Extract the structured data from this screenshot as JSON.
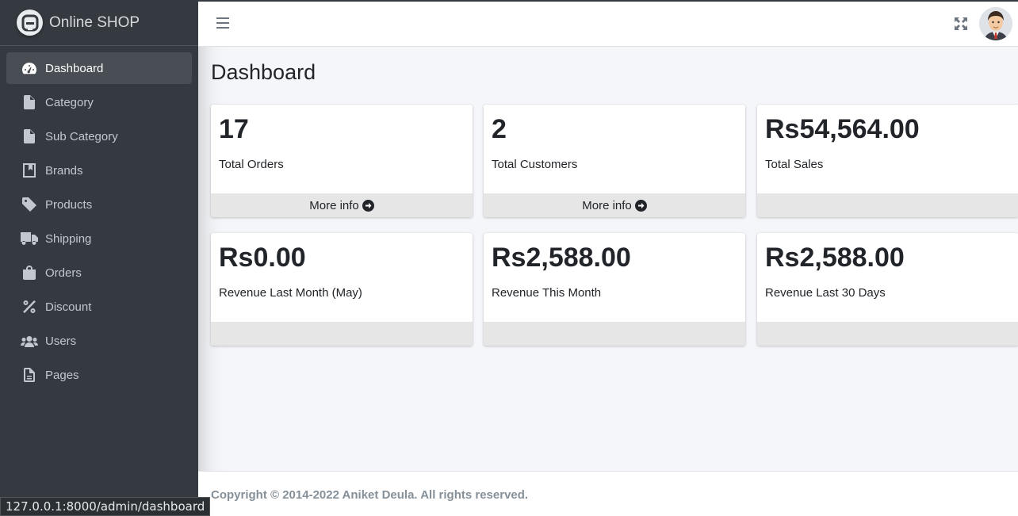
{
  "brand": {
    "name": "Online SHOP"
  },
  "sidebar": {
    "items": [
      {
        "label": "Dashboard",
        "icon": "tachometer-icon",
        "active": true
      },
      {
        "label": "Category",
        "icon": "file-icon"
      },
      {
        "label": "Sub Category",
        "icon": "file-icon"
      },
      {
        "label": "Brands",
        "icon": "book-icon"
      },
      {
        "label": "Products",
        "icon": "tag-icon"
      },
      {
        "label": "Shipping",
        "icon": "truck-icon"
      },
      {
        "label": "Orders",
        "icon": "shopping-bag-icon"
      },
      {
        "label": "Discount",
        "icon": "percent-icon"
      },
      {
        "label": "Users",
        "icon": "users-icon"
      },
      {
        "label": "Pages",
        "icon": "file-alt-icon"
      }
    ]
  },
  "header": {
    "menu_icon": "bars-icon",
    "expand_icon": "expand-icon"
  },
  "page": {
    "title": "Dashboard"
  },
  "cards": [
    {
      "value": "17",
      "label": "Total Orders",
      "footer": "More info"
    },
    {
      "value": "2",
      "label": "Total Customers",
      "footer": "More info"
    },
    {
      "value": "Rs54,564.00",
      "label": "Total Sales",
      "footer": ""
    },
    {
      "value": "Rs0.00",
      "label": "Revenue Last Month (May)",
      "footer": ""
    },
    {
      "value": "Rs2,588.00",
      "label": "Revenue This Month",
      "footer": ""
    },
    {
      "value": "Rs2,588.00",
      "label": "Revenue Last 30 Days",
      "footer": ""
    }
  ],
  "footer": {
    "copyright": "Copyright © 2014-2022 Aniket Deula. All rights reserved."
  },
  "status_url": "127.0.0.1:8000/admin/dashboard",
  "colors": {
    "sidebar_bg": "#343a40",
    "content_bg": "#f4f6f9",
    "card_footer_bg": "#e6e6e6"
  }
}
